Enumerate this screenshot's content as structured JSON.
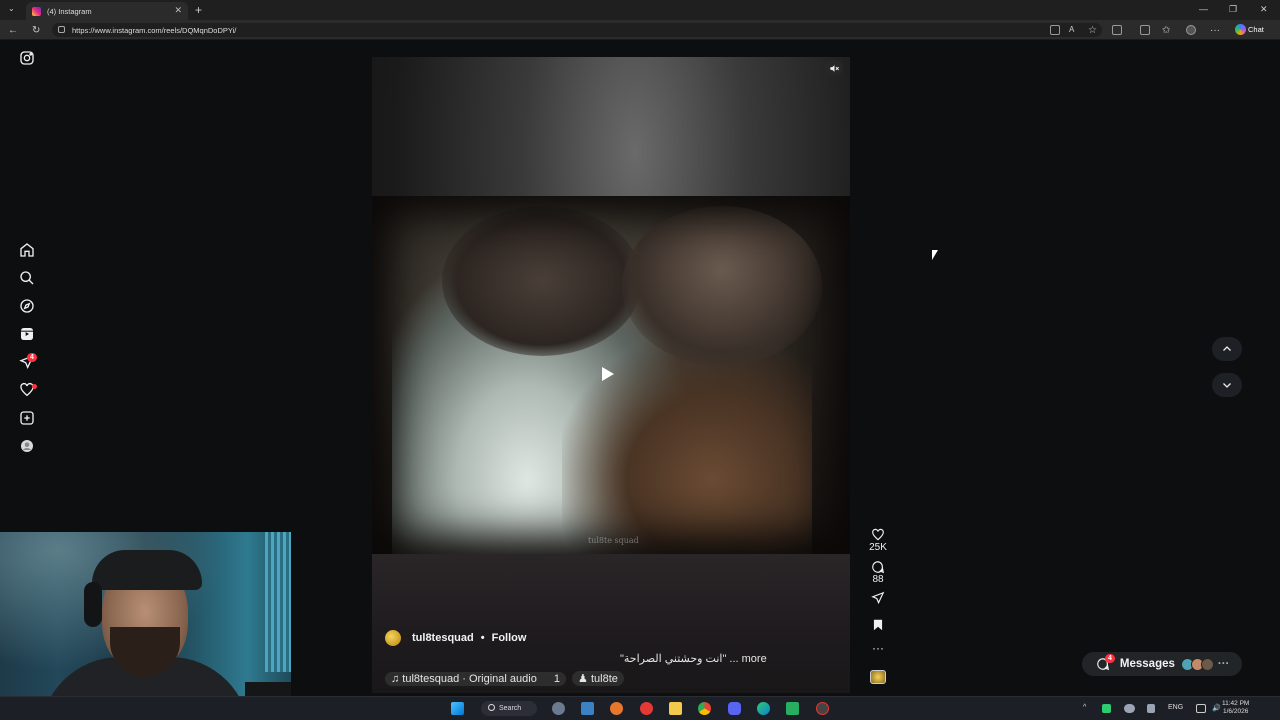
{
  "browser": {
    "tab_title": "(4) Instagram",
    "url": "https://www.instagram.com/reels/DQMqnDoDPYi/",
    "chat_label": "Chat"
  },
  "sidebar": {
    "items": [
      {
        "name": "instagram-logo-icon"
      },
      {
        "name": "home-icon"
      },
      {
        "name": "search-icon"
      },
      {
        "name": "explore-icon"
      },
      {
        "name": "reels-icon"
      },
      {
        "name": "direct-messages-icon",
        "badge": "4"
      },
      {
        "name": "notifications-icon"
      },
      {
        "name": "create-icon"
      },
      {
        "name": "profile-avatar"
      }
    ]
  },
  "reel": {
    "watermark": "tul8te squad",
    "likes": "25K",
    "comments": "88",
    "author": "tul8tesquad",
    "separator": "•",
    "follow_label": "Follow",
    "caption": "\"انت وحشتني الصراحة\" ... more",
    "audio_label": "♫ tul8tesquad · Original audio",
    "audio_count": "1",
    "tagged_user": "tul8te",
    "tagged_prefix": "♟"
  },
  "messages": {
    "label": "Messages",
    "badge": "4",
    "more": "···"
  },
  "taskbar": {
    "search_label": "Search",
    "language": "ENG",
    "time": "11:42 PM",
    "date": "1/6/2026"
  },
  "colors": {
    "badge_red": "#ff3040",
    "page_bg": "#0c0e10",
    "text": "#f2f2f2"
  }
}
